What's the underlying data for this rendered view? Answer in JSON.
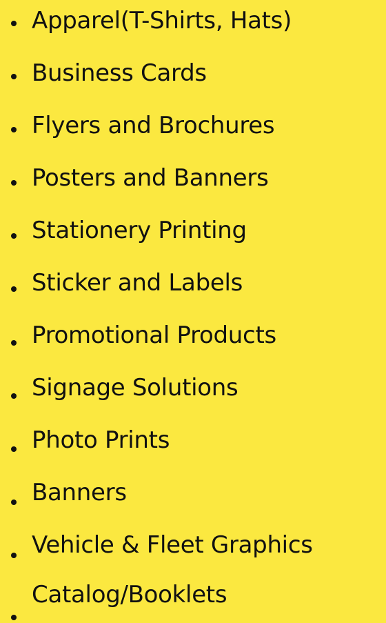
{
  "background_color": "#fbe840",
  "text_color": "#111111",
  "bullet_icon": "bullet-dot",
  "items": [
    {
      "label": "Apparel(T-Shirts, Hats)"
    },
    {
      "label": "Business Cards"
    },
    {
      "label": "Flyers and Brochures"
    },
    {
      "label": "Posters and Banners"
    },
    {
      "label": "Stationery Printing"
    },
    {
      "label": "Sticker and Labels"
    },
    {
      "label": "Promotional Products"
    },
    {
      "label": "Signage Solutions"
    },
    {
      "label": "Photo Prints"
    },
    {
      "label": "Banners"
    },
    {
      "label": "Vehicle & Fleet Graphics"
    },
    {
      "label": "Catalog/Booklets"
    }
  ]
}
